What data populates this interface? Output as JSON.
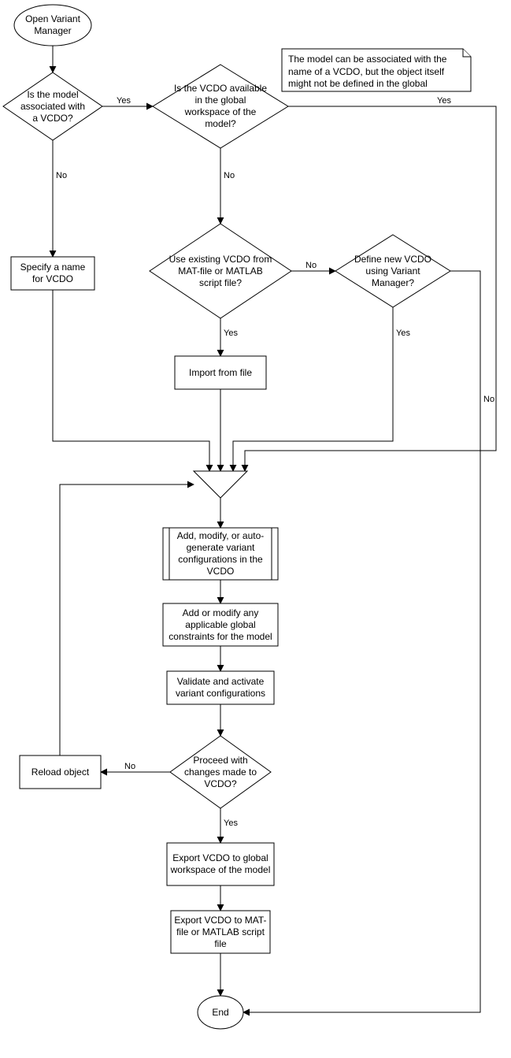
{
  "nodes": {
    "start": "Open Variant Manager",
    "d1": "Is the model associated with a VCDO?",
    "d2": "Is the VCDO available in the global workspace of the model?",
    "d3": "Use existing VCDO from MAT-file or MATLAB script file?",
    "d4": "Define new VCDO using Variant Manager?",
    "p_specify": "Specify a name for VCDO",
    "p_import": "Import from file",
    "p_addmodify": "Add, modify, or auto-generate variant configurations in the VCDO",
    "p_constraints": "Add or modify any applicable global constraints for the model",
    "p_validate": "Validate and activate variant configurations",
    "d5": "Proceed with changes made to VCDO?",
    "p_reload": "Reload object",
    "p_exportws": "Export VCDO to global workspace of the model",
    "p_exportfile": "Export VCDO to MAT-file or MATLAB script file",
    "end": "End",
    "note": "The model can be associated with the name of a VCDO, but the object itself might not be defined in the global workspace of the model."
  },
  "edge_labels": {
    "yes": "Yes",
    "no": "No"
  }
}
